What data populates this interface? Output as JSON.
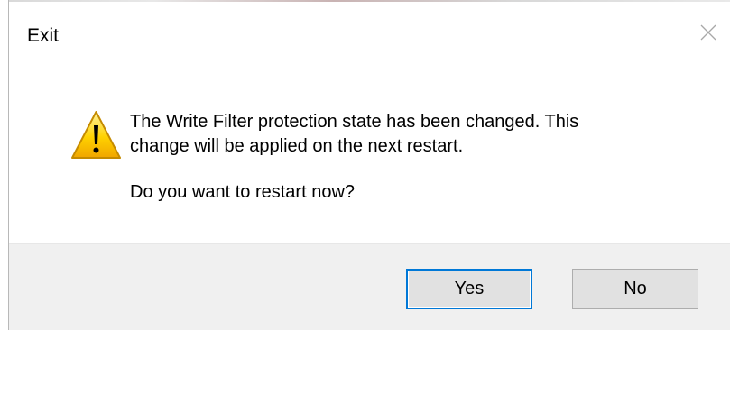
{
  "dialog": {
    "title": "Exit",
    "close_icon": "close-icon",
    "warning_icon": "warning-icon",
    "message_line1": "The Write Filter protection state has been changed. This",
    "message_line2": "change will be applied on the next restart.",
    "question": "Do you want to restart now?",
    "buttons": {
      "yes_label": "Yes",
      "no_label": "No"
    },
    "colors": {
      "focus_border": "#0078d7",
      "button_bar": "#f0f0f0",
      "button_face": "#e1e1e1"
    }
  }
}
